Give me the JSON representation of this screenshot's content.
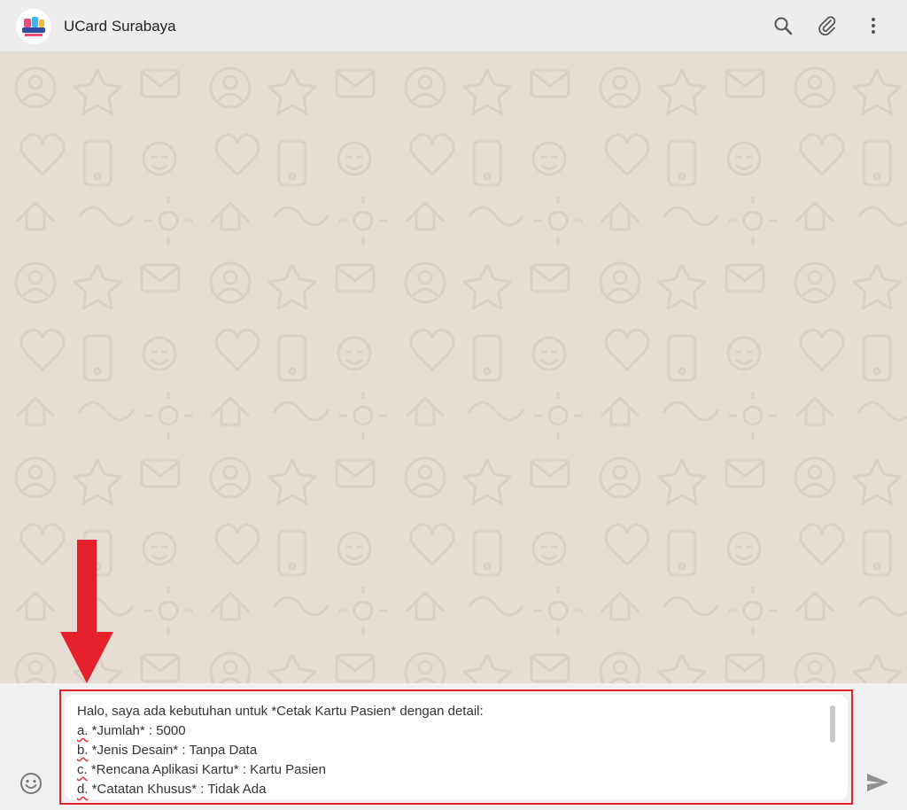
{
  "chat": {
    "contact_name": "UCard Surabaya",
    "avatar_icon": "ucard-logo-avatar",
    "header_icons": [
      "search-icon",
      "paperclip-icon",
      "more-vertical-icon"
    ]
  },
  "composer": {
    "lines": [
      {
        "prefix": "",
        "text": "Halo, saya ada kebutuhan untuk *Cetak Kartu Pasien* dengan detail:"
      },
      {
        "prefix": "a.",
        "text": " *Jumlah* : 5000"
      },
      {
        "prefix": "b.",
        "text": " *Jenis Desain* : Tanpa Data"
      },
      {
        "prefix": "c.",
        "text": " *Rencana Aplikasi Kartu* : Kartu Pasien"
      },
      {
        "prefix": "d.",
        "text": " *Catatan Khusus* : Tidak Ada"
      }
    ]
  },
  "footer": {
    "emoji_icon": "emoji-icon",
    "send_icon": "send-icon"
  },
  "colors": {
    "header_bg": "#ededed",
    "chat_bg": "#e6ddd4",
    "pattern": "#d8cfc5",
    "highlight_red": "#e5222c"
  }
}
